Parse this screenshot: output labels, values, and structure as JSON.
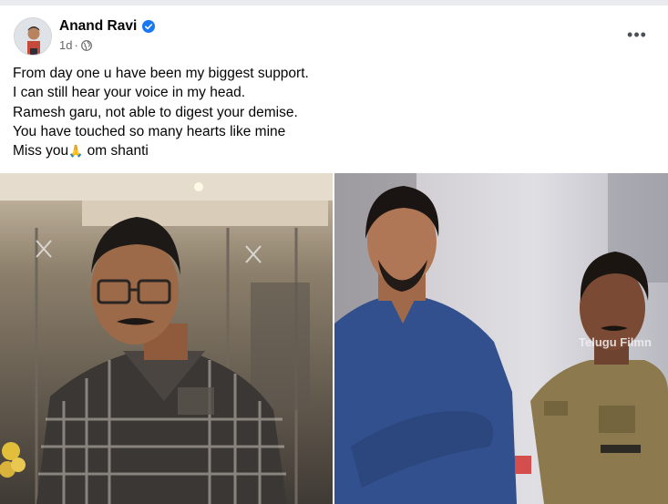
{
  "post": {
    "author": "Anand Ravi",
    "timestamp": "1d",
    "separator": "·",
    "more_label": "•••",
    "lines": [
      "From day one u have been my biggest support.",
      "I can still hear your voice in my head.",
      "Ramesh garu, not able to digest your demise.",
      "You have touched so many hearts like mine"
    ],
    "last_line_prefix": "Miss you",
    "last_line_emoji": "🙏",
    "last_line_suffix": " om shanti"
  },
  "photos": {
    "right_watermark": "Telugu Filmn"
  },
  "colors": {
    "verified": "#1877f2",
    "secondary_text": "#65676b"
  }
}
